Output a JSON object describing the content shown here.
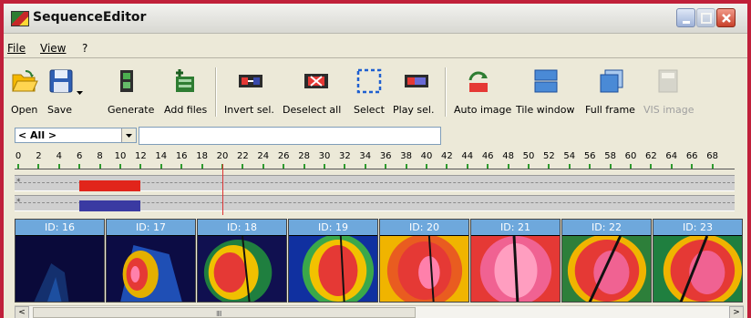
{
  "window": {
    "title": "SequenceEditor"
  },
  "menu": [
    {
      "key": "file",
      "label": "File"
    },
    {
      "key": "view",
      "label": "View"
    },
    {
      "key": "help",
      "label": "?"
    }
  ],
  "toolbar": {
    "items": [
      {
        "key": "open",
        "label": "Open",
        "icon": "folder-open-icon"
      },
      {
        "key": "save",
        "label": "Save",
        "icon": "floppy-disk-icon"
      },
      {
        "key": "generate",
        "label": "Generate",
        "icon": "generate-icon"
      },
      {
        "key": "add_files",
        "label": "Add files",
        "icon": "add-files-icon"
      },
      {
        "key": "invert_sel",
        "label": "Invert sel.",
        "icon": "invert-selection-icon"
      },
      {
        "key": "deselect_all",
        "label": "Deselect all",
        "icon": "deselect-all-icon"
      },
      {
        "key": "select",
        "label": "Select",
        "icon": "select-marquee-icon"
      },
      {
        "key": "play_sel",
        "label": "Play sel.",
        "icon": "film-play-icon"
      },
      {
        "key": "auto_image",
        "label": "Auto image",
        "icon": "auto-image-icon"
      },
      {
        "key": "tile_window",
        "label": "Tile window",
        "icon": "tile-window-icon"
      },
      {
        "key": "full_frame",
        "label": "Full frame",
        "icon": "full-frame-icon"
      },
      {
        "key": "vis_image",
        "label": "VIS image",
        "icon": "vis-image-icon",
        "disabled": true
      }
    ]
  },
  "filter": {
    "combo_value": "< All >",
    "text_value": ""
  },
  "timeline": {
    "ruler_labels": [
      "0",
      "2",
      "4",
      "6",
      "8",
      "10",
      "12",
      "14",
      "16",
      "18",
      "20",
      "22",
      "24",
      "26",
      "28",
      "30",
      "32",
      "34",
      "36",
      "38",
      "40",
      "42",
      "44",
      "46",
      "48",
      "50",
      "52",
      "54",
      "56",
      "58",
      "60",
      "62",
      "64",
      "66",
      "68"
    ],
    "track_marks": [
      "*",
      "*"
    ],
    "selection_start": 6,
    "selection_end": 12,
    "cursor": 20
  },
  "thumbnails": [
    {
      "label": "ID: 16"
    },
    {
      "label": "ID: 17"
    },
    {
      "label": "ID: 18"
    },
    {
      "label": "ID: 19"
    },
    {
      "label": "ID: 20"
    },
    {
      "label": "ID: 21"
    },
    {
      "label": "ID: 22"
    },
    {
      "label": "ID: 23"
    }
  ],
  "scrollbar": {
    "left_arrow": "<",
    "right_arrow": ">",
    "grip": "IIII"
  }
}
